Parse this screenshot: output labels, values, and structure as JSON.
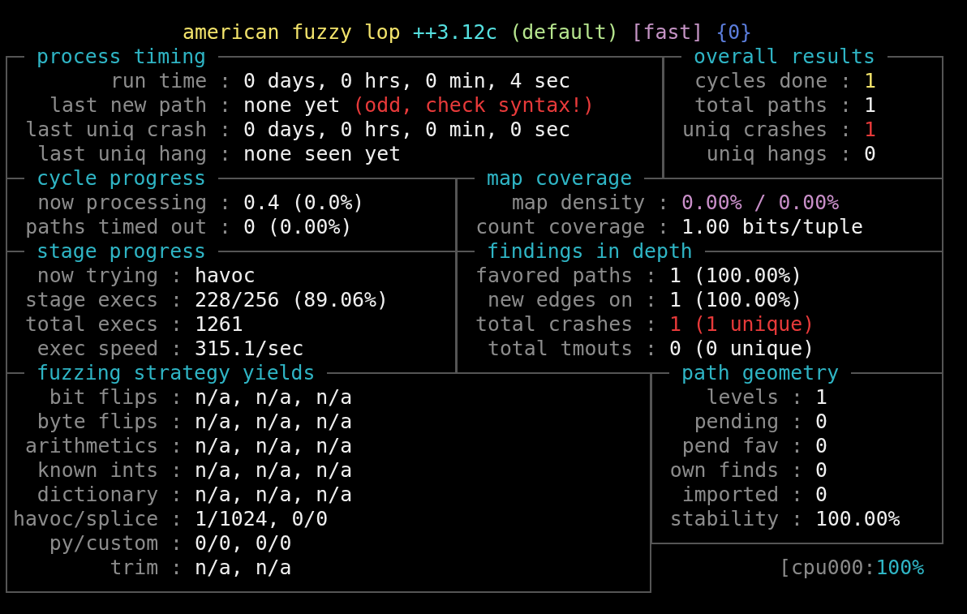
{
  "title": [
    {
      "text": "american fuzzy lop",
      "color": "#f2e36b"
    },
    {
      "text": "++3.12c",
      "color": "#55e0e0"
    },
    {
      "text": "(default)",
      "color": "#b6e58e"
    },
    {
      "text": "[fast]",
      "color": "#c594c5"
    },
    {
      "text": "{0}",
      "color": "#5b7ddb"
    }
  ],
  "panels": [
    {
      "title": "process timing",
      "rows": [
        {
          "key": "run time :",
          "value": [
            {
              "text": "0 days, 0 hrs, 0 min, 4 sec",
              "color": "#f0f0f0"
            }
          ]
        },
        {
          "key": "last new path :",
          "value": [
            {
              "text": "none yet ",
              "color": "#f0f0f0"
            },
            {
              "text": "(odd, check syntax!)",
              "color": "#e83a3a"
            }
          ]
        },
        {
          "key": "last uniq crash :",
          "value": [
            {
              "text": "0 days, 0 hrs, 0 min, 0 sec",
              "color": "#f0f0f0"
            }
          ]
        },
        {
          "key": "last uniq hang :",
          "value": [
            {
              "text": "none seen yet",
              "color": "#f0f0f0"
            }
          ]
        }
      ]
    },
    {
      "title": "overall results",
      "rows": [
        {
          "key": "cycles done :",
          "value": [
            {
              "text": "1",
              "color": "#f2e36b"
            }
          ]
        },
        {
          "key": "total paths :",
          "value": [
            {
              "text": "1",
              "color": "#f0f0f0"
            }
          ]
        },
        {
          "key": "uniq crashes :",
          "value": [
            {
              "text": "1",
              "color": "#e83a3a"
            }
          ]
        },
        {
          "key": "uniq hangs :",
          "value": [
            {
              "text": "0",
              "color": "#f0f0f0"
            }
          ]
        }
      ]
    },
    {
      "title": "cycle progress",
      "rows": [
        {
          "key": "now processing :",
          "value": [
            {
              "text": "0.4 (0.0%)",
              "color": "#f0f0f0"
            }
          ]
        },
        {
          "key": "paths timed out :",
          "value": [
            {
              "text": "0 (0.00%)",
              "color": "#f0f0f0"
            }
          ]
        }
      ]
    },
    {
      "title": "map coverage",
      "rows": [
        {
          "key": "map density :",
          "value": [
            {
              "text": "0.00% / 0.00%",
              "color": "#c98fc9"
            }
          ]
        },
        {
          "key": "count coverage :",
          "value": [
            {
              "text": "1.00 bits/tuple",
              "color": "#f0f0f0"
            }
          ]
        }
      ]
    },
    {
      "title": "stage progress",
      "rows": [
        {
          "key": "now trying :",
          "value": [
            {
              "text": "havoc",
              "color": "#f0f0f0"
            }
          ]
        },
        {
          "key": "stage execs :",
          "value": [
            {
              "text": "228/256 (89.06%)",
              "color": "#f0f0f0"
            }
          ]
        },
        {
          "key": "total execs :",
          "value": [
            {
              "text": "1261",
              "color": "#f0f0f0"
            }
          ]
        },
        {
          "key": "exec speed :",
          "value": [
            {
              "text": "315.1/sec",
              "color": "#f0f0f0"
            }
          ]
        }
      ]
    },
    {
      "title": "findings in depth",
      "rows": [
        {
          "key": "favored paths :",
          "value": [
            {
              "text": "1 (100.00%)",
              "color": "#f0f0f0"
            }
          ]
        },
        {
          "key": "new edges on :",
          "value": [
            {
              "text": "1 (100.00%)",
              "color": "#f0f0f0"
            }
          ]
        },
        {
          "key": "total crashes :",
          "value": [
            {
              "text": "1 (1 unique)",
              "color": "#e83a3a"
            }
          ]
        },
        {
          "key": "total tmouts :",
          "value": [
            {
              "text": "0 (0 unique)",
              "color": "#f0f0f0"
            }
          ]
        }
      ]
    },
    {
      "title": "fuzzing strategy yields",
      "rows": [
        {
          "key": "bit flips :",
          "value": [
            {
              "text": "n/a, n/a, n/a",
              "color": "#f0f0f0"
            }
          ]
        },
        {
          "key": "byte flips :",
          "value": [
            {
              "text": "n/a, n/a, n/a",
              "color": "#f0f0f0"
            }
          ]
        },
        {
          "key": "arithmetics :",
          "value": [
            {
              "text": "n/a, n/a, n/a",
              "color": "#f0f0f0"
            }
          ]
        },
        {
          "key": "known ints :",
          "value": [
            {
              "text": "n/a, n/a, n/a",
              "color": "#f0f0f0"
            }
          ]
        },
        {
          "key": "dictionary :",
          "value": [
            {
              "text": "n/a, n/a, n/a",
              "color": "#f0f0f0"
            }
          ]
        },
        {
          "key": "havoc/splice :",
          "value": [
            {
              "text": "1/1024, 0/0",
              "color": "#f0f0f0"
            }
          ]
        },
        {
          "key": "py/custom :",
          "value": [
            {
              "text": "0/0, 0/0",
              "color": "#f0f0f0"
            }
          ]
        },
        {
          "key": "trim :",
          "value": [
            {
              "text": "n/a, n/a",
              "color": "#f0f0f0"
            }
          ]
        }
      ]
    },
    {
      "title": "path geometry",
      "rows": [
        {
          "key": "levels :",
          "value": [
            {
              "text": "1",
              "color": "#f0f0f0"
            }
          ]
        },
        {
          "key": "pending :",
          "value": [
            {
              "text": "0",
              "color": "#f0f0f0"
            }
          ]
        },
        {
          "key": "pend fav :",
          "value": [
            {
              "text": "0",
              "color": "#f0f0f0"
            }
          ]
        },
        {
          "key": "own finds :",
          "value": [
            {
              "text": "0",
              "color": "#f0f0f0"
            }
          ]
        },
        {
          "key": "imported :",
          "value": [
            {
              "text": "0",
              "color": "#f0f0f0"
            }
          ]
        },
        {
          "key": "stability :",
          "value": [
            {
              "text": "100.00%",
              "color": "#f0f0f0"
            }
          ]
        }
      ]
    }
  ],
  "cpu": [
    {
      "text": "[cpu000:",
      "color": "#8a8a8a"
    },
    {
      "text": "100%",
      "color": "#2fb5c5"
    }
  ]
}
